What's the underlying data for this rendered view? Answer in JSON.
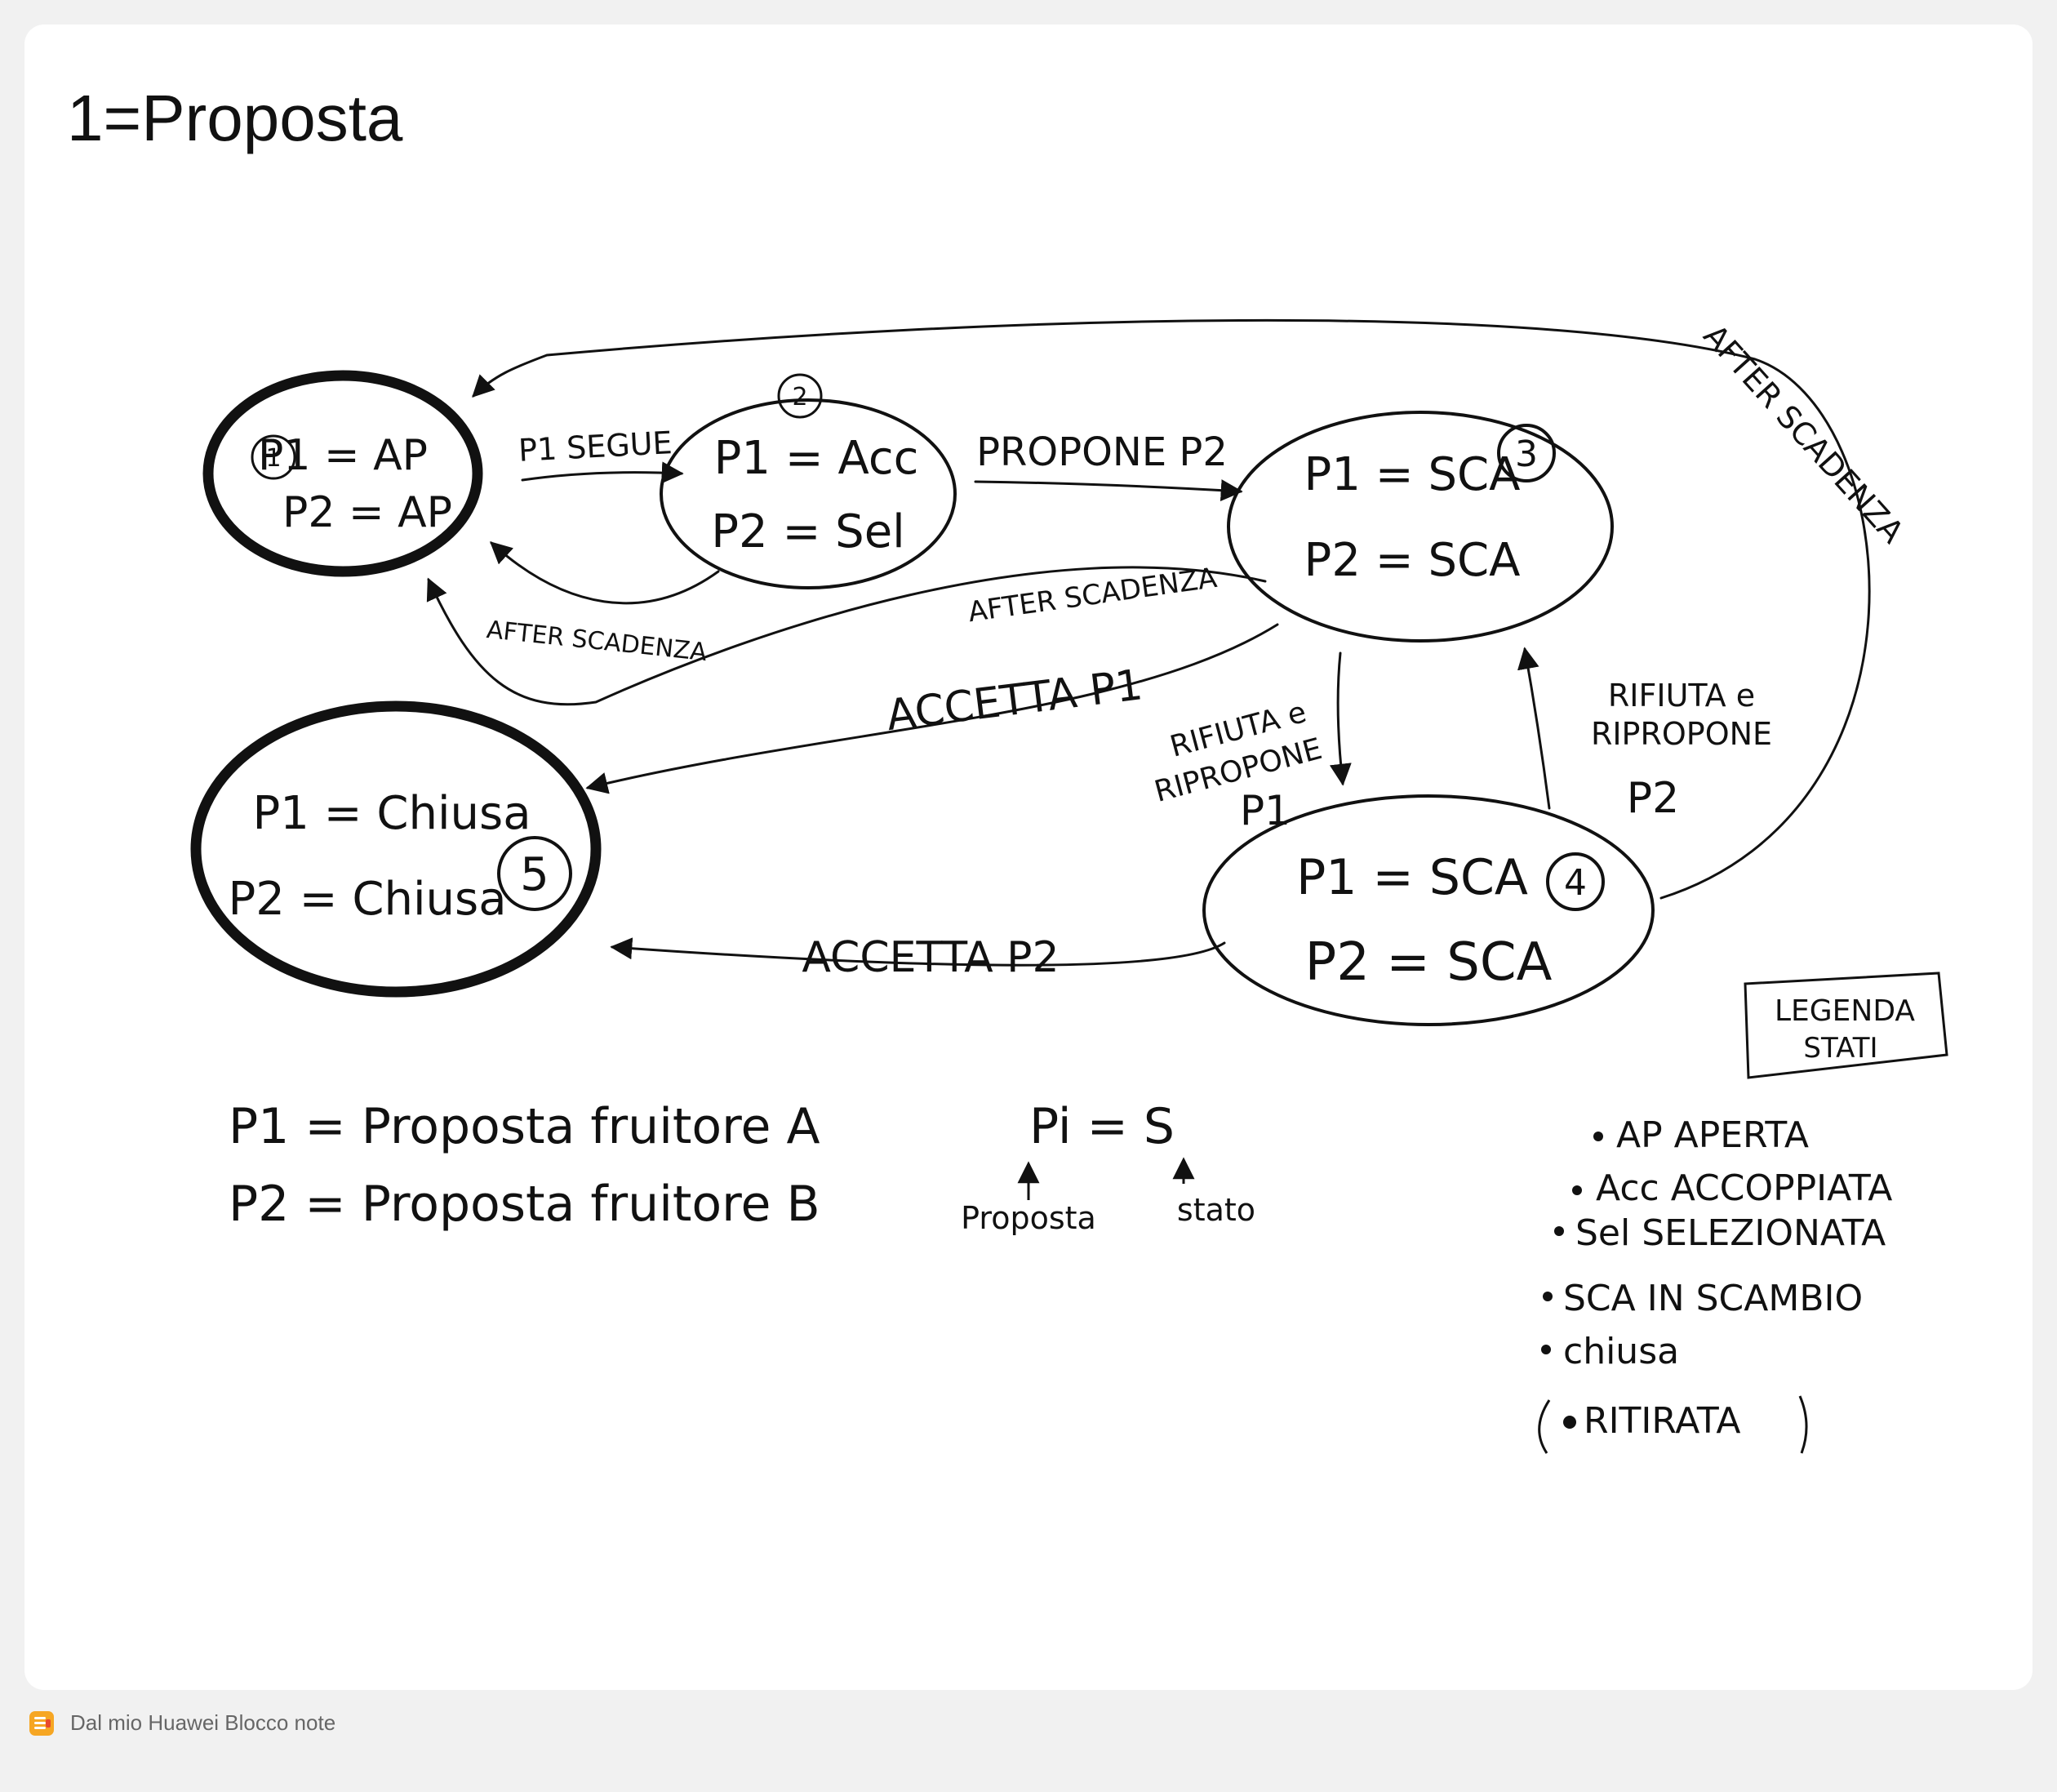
{
  "note": {
    "title": "1=Proposta"
  },
  "diagram": {
    "states": [
      {
        "number": "1",
        "p1": "P1 = AP",
        "p2": "P2 = AP"
      },
      {
        "number": "2",
        "p1": "P1 = Acc",
        "p2": "P2 = Sel"
      },
      {
        "number": "3",
        "p1": "P1 = SCA",
        "p2": "P2 = SCA"
      },
      {
        "number": "4",
        "p1": "P1 = SCA",
        "p2": "P2 = SCA"
      },
      {
        "number": "5",
        "p1": "P1 = Chiusa",
        "p2": "P2 = Chiusa"
      }
    ],
    "transitions": {
      "p1_segue": "P1 SEGUE",
      "after_scadenza_2_1": "AFTER SCADENZA",
      "propone_p2": "PROPONE P2",
      "after_scadenza_3_1": "AFTER SCADENZA",
      "accetta_p1": "ACCETTA P1",
      "after_scadenza_4_1": "AFTER SCADENZA",
      "rifiuta_p1_line1": "RIFIUTA e",
      "rifiuta_p1_line2": "RIPROPONE",
      "rifiuta_p1_line3": "P1",
      "rifiuta_p2_line1": "RIFIUTA e",
      "rifiuta_p2_line2": "RIPROPONE",
      "rifiuta_p2_line3": "P2",
      "accetta_p2": "ACCETTA P2"
    },
    "definitions": {
      "p1_def": "P1 = Proposta fruitore A",
      "p2_def": "P2 = Proposta fruitore B",
      "formula": "Pi = S",
      "formula_left": "Proposta",
      "formula_right": "stato"
    },
    "legend": {
      "title_line1": "LEGENDA",
      "title_line2": "STATI",
      "items": [
        "AP APERTA",
        "Acc ACCOPPIATA",
        "Sel SELEZIONATA",
        "SCA IN SCAMBIO",
        "chiusa",
        "RITIRATA"
      ]
    }
  },
  "footer": {
    "text": "Dal mio Huawei Blocco note"
  }
}
